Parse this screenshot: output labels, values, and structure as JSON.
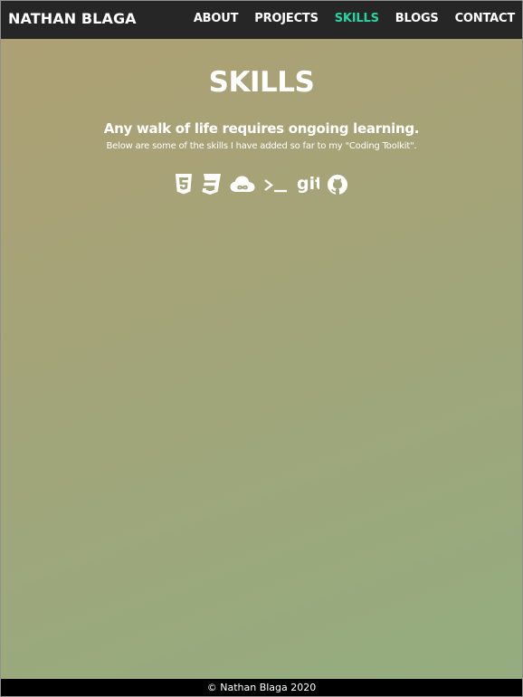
{
  "brand": {
    "name": "NATHAN BLAGA"
  },
  "nav": {
    "items": [
      {
        "label": "ABOUT"
      },
      {
        "label": "PROJECTS"
      },
      {
        "label": "SKILLS"
      },
      {
        "label": "BLOGS"
      },
      {
        "label": "CONTACT"
      }
    ],
    "active": "SKILLS"
  },
  "colors": {
    "navbar_bg": "#262626",
    "active_link": "#2ad39e",
    "text": "#ffffff",
    "footer_bg": "#000000"
  },
  "main": {
    "title": "SKILLS",
    "subtitle": "Any walk of life requires ongoing learning.",
    "description": "Below are some of the skills I have added so far to my \"Coding Toolkit\"."
  },
  "skills": {
    "icons": [
      "html5-icon",
      "css3-icon",
      "cloud-icon",
      "terminal-icon",
      "git-icon",
      "github-icon"
    ],
    "git_text": "git",
    "terminal_text": ">_"
  },
  "footer": {
    "text": "© Nathan Blaga 2020"
  }
}
